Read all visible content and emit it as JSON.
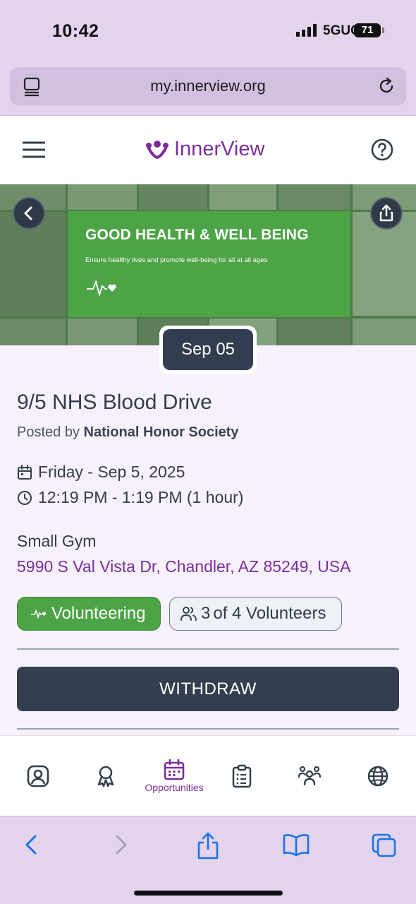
{
  "status_bar": {
    "time": "10:42",
    "network": "5GUC",
    "battery": "71"
  },
  "browser": {
    "url": "my.innerview.org"
  },
  "app": {
    "logo_text": "InnerView"
  },
  "banner": {
    "title": "GOOD HEALTH & WELL BEING",
    "subtitle": "Ensure healthy lives and promote well-being for all at all ages"
  },
  "event": {
    "date_chip": "Sep 05",
    "title": "9/5 NHS Blood Drive",
    "posted_prefix": "Posted by",
    "posted_by": "National Honor Society",
    "date": "Friday - Sep 5, 2025",
    "time": "12:19 PM - 1:19 PM (1 hour)",
    "venue": "Small Gym",
    "address": "5990 S Val Vista Dr, Chandler, AZ 85249, USA",
    "category_tag": "Volunteering",
    "volunteers_count": "3",
    "volunteers_of": "of 4 Volunteers",
    "action_label": "WITHDRAW"
  },
  "bottom_nav": {
    "active_label": "Opportunities",
    "items": [
      "profile",
      "achievements",
      "opportunities",
      "tasks",
      "groups",
      "global"
    ]
  },
  "colors": {
    "brand_purple": "#7b2d9a",
    "sdg_green": "#4da447",
    "dark_navy": "#333e4e",
    "browser_tint": "#e3d3ec"
  }
}
